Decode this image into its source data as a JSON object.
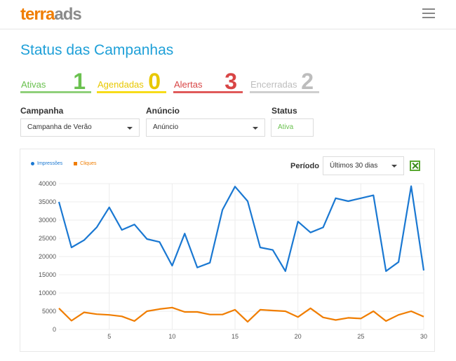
{
  "header": {
    "logo_part1": "terra",
    "logo_part2": "ads",
    "menu_icon": "hamburger-menu-icon"
  },
  "page_title": "Status das Campanhas",
  "stats": [
    {
      "label": "Ativas",
      "count": "1",
      "color": "#6ac14f"
    },
    {
      "label": "Agendadas",
      "count": "0",
      "color": "#e8c800"
    },
    {
      "label": "Alertas",
      "count": "3",
      "color": "#d84545"
    },
    {
      "label": "Encerradas",
      "count": "2",
      "color": "#bdbdbd"
    }
  ],
  "filters": {
    "campanha": {
      "label": "Campanha",
      "value": "Campanha de Verão"
    },
    "anuncio": {
      "label": "Anúncio",
      "value": "Anúncio"
    },
    "status": {
      "label": "Status",
      "value": "Ativa"
    }
  },
  "chart_panel": {
    "periodo_label": "Período",
    "periodo_value": "Últimos 30 dias",
    "export_icon": "excel-export-icon"
  },
  "chart_data": {
    "type": "line",
    "x": [
      1,
      2,
      3,
      4,
      5,
      6,
      7,
      8,
      9,
      10,
      11,
      12,
      13,
      14,
      15,
      16,
      17,
      18,
      19,
      20,
      21,
      22,
      23,
      24,
      25,
      26,
      27,
      28,
      29,
      30
    ],
    "series": [
      {
        "name": "Impressões",
        "color": "#1a78d2",
        "values": [
          35000,
          22500,
          24500,
          28000,
          33500,
          27300,
          28800,
          24800,
          24000,
          17500,
          26300,
          17000,
          18300,
          32800,
          39200,
          35200,
          22500,
          21800,
          16000,
          29600,
          26600,
          28000,
          36000,
          35200,
          36000,
          36800,
          16000,
          18500,
          39300,
          16200
        ]
      },
      {
        "name": "Cliques",
        "color": "#f07d00",
        "values": [
          5800,
          2400,
          4700,
          4200,
          4000,
          3600,
          2300,
          5000,
          5600,
          6000,
          4800,
          4800,
          4100,
          4100,
          5400,
          2100,
          5400,
          5200,
          5000,
          3400,
          5800,
          3300,
          2600,
          3200,
          3000,
          5000,
          2300,
          4000,
          5000,
          3500
        ]
      }
    ],
    "ylim": [
      0,
      40000
    ],
    "yticks": [
      0,
      5000,
      10000,
      15000,
      20000,
      25000,
      30000,
      35000,
      40000
    ],
    "xticks": [
      5,
      10,
      15,
      20,
      25,
      30
    ],
    "grid": true,
    "legend": "top-left"
  }
}
